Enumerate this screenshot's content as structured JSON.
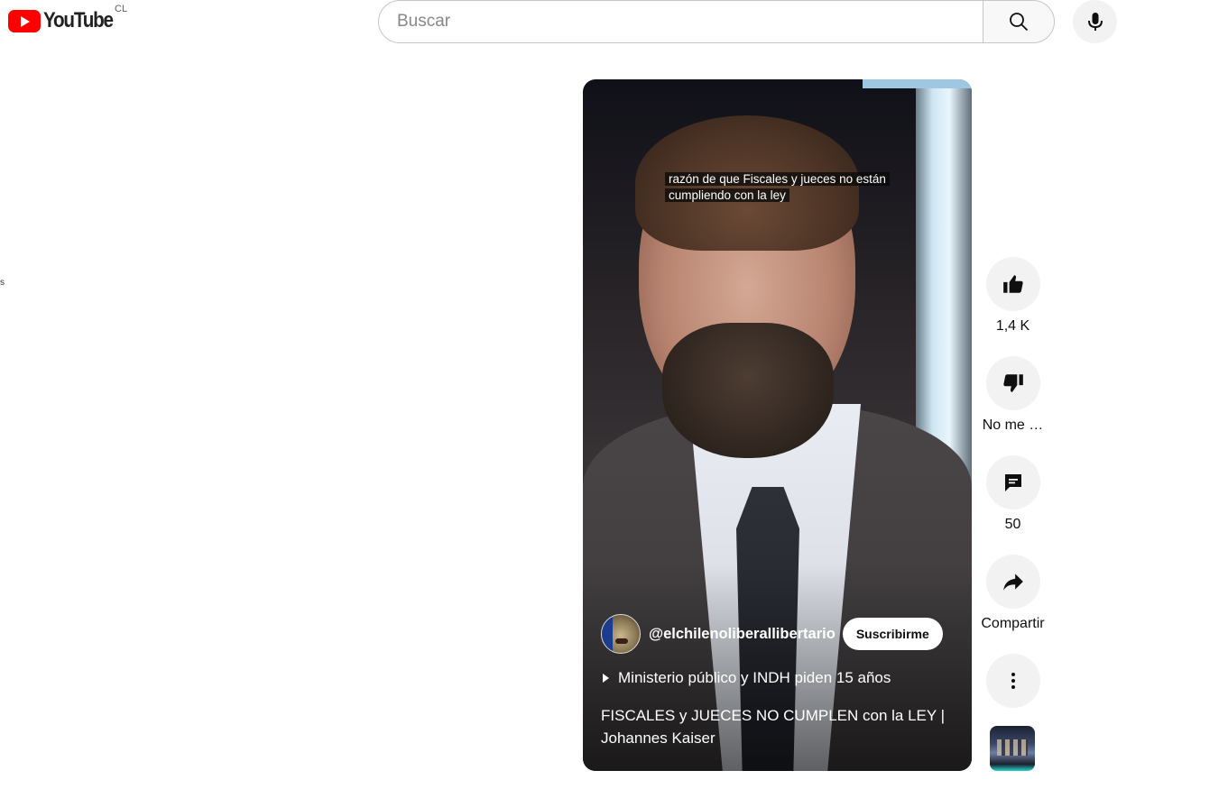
{
  "header": {
    "logo_text": "YouTube",
    "country_code": "CL",
    "search_placeholder": "Buscar",
    "search_icon": "search-icon",
    "mic_icon": "microphone-icon"
  },
  "sidebar_fragment": "s",
  "video": {
    "caption_line1": "razón de que Fiscales y jueces no están",
    "caption_line2": "cumpliendo con la ley",
    "channel_handle": "@elchilenoliberallibertario",
    "subscribe_label": "Suscribirme",
    "playlist_text": "Ministerio público y INDH piden 15 años",
    "title": "FISCALES y JUECES NO CUMPLEN con la LEY | Johannes Kaiser"
  },
  "actions": {
    "like": {
      "icon": "thumbs-up-icon",
      "label": "1,4 K"
    },
    "dislike": {
      "icon": "thumbs-down-icon",
      "label": "No me …"
    },
    "comments": {
      "icon": "comment-icon",
      "label": "50"
    },
    "share": {
      "icon": "share-icon",
      "label": "Compartir"
    },
    "more": {
      "icon": "more-vertical-icon"
    },
    "remix_thumbnail": "remix-thumbnail"
  },
  "colors": {
    "brand": "#ff0000",
    "action_bg": "#f2f2f2",
    "text": "#0f0f0f"
  }
}
